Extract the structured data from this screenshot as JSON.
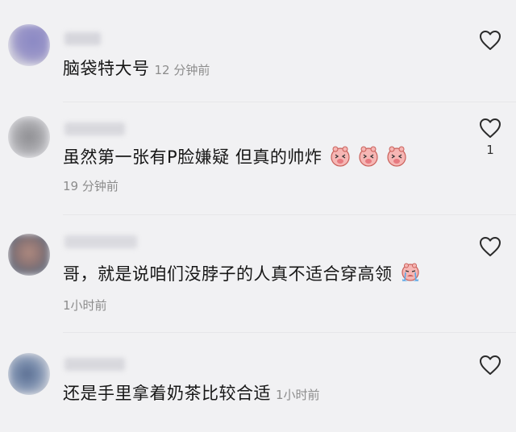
{
  "comments": [
    {
      "text": "脑袋特大号",
      "time": "12 分钟前",
      "likes": ""
    },
    {
      "text": "虽然第一张有P脸嫌疑 但真的帅炸",
      "time": "19 分钟前",
      "likes": "1",
      "emojis": [
        "pig-face-emoji",
        "pig-face-emoji",
        "pig-face-emoji"
      ]
    },
    {
      "text": "哥，就是说咱们没脖子的人真不适合穿高领",
      "time": "1小时前",
      "likes": "",
      "emojis": [
        "crying-pig-emoji"
      ]
    },
    {
      "text": "还是手里拿着奶茶比较合适",
      "time": "1小时前",
      "likes": ""
    }
  ],
  "icons": {
    "like": "heart-outline-icon"
  },
  "colors": {
    "background": "#f1f1f3",
    "text": "#161616",
    "meta": "#8c8c8c"
  }
}
